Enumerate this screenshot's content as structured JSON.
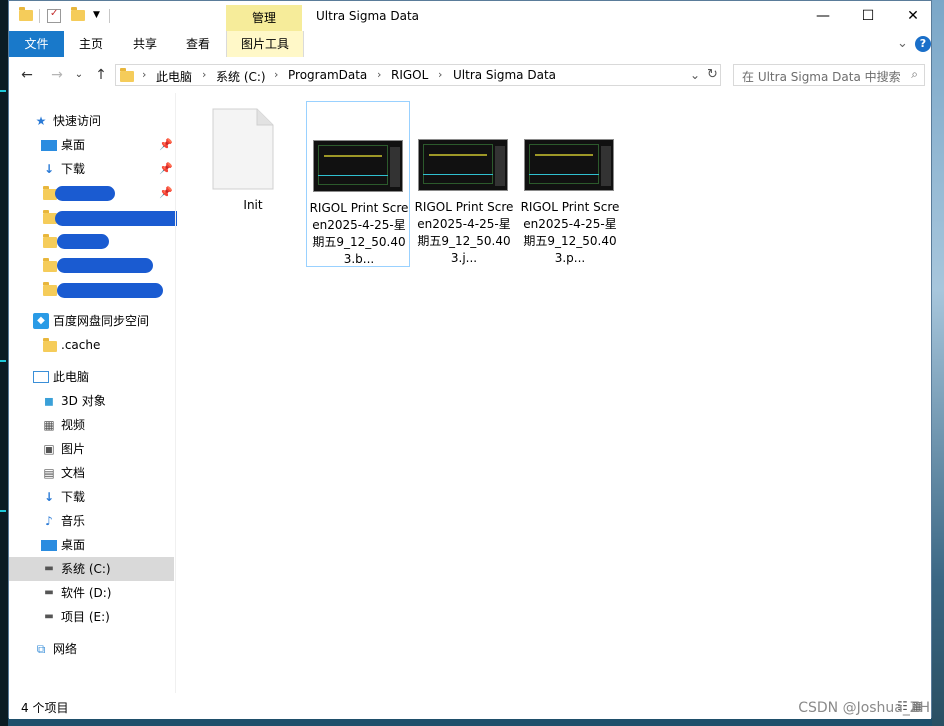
{
  "titlebar": {
    "manage_tab": "管理",
    "title": "Ultra Sigma Data",
    "minimize": "—",
    "maximize": "☐",
    "close": "✕"
  },
  "ribbon": {
    "tabs": [
      "文件",
      "主页",
      "共享",
      "查看",
      "图片工具"
    ],
    "expand": "⌄",
    "help": "?"
  },
  "address": {
    "segments": [
      "此电脑",
      "系统 (C:)",
      "ProgramData",
      "RIGOL",
      "Ultra Sigma Data"
    ],
    "search_placeholder": "在 Ultra Sigma Data 中搜索"
  },
  "sidebar": {
    "quick_access": "快速访问",
    "quick_items": [
      "桌面",
      "下载"
    ],
    "baidu": "百度网盘同步空间",
    "cache": ".cache",
    "this_pc": "此电脑",
    "pc_items": [
      "3D 对象",
      "视频",
      "图片",
      "文档",
      "下载",
      "音乐",
      "桌面",
      "系统 (C:)",
      "软件 (D:)",
      "项目 (E:)"
    ],
    "network": "网络"
  },
  "files": [
    {
      "name": "Init"
    },
    {
      "name": "RIGOL Print Screen2025-4-25-星期五9_12_50.403.b..."
    },
    {
      "name": "RIGOL Print Screen2025-4-25-星期五9_12_50.403.j..."
    },
    {
      "name": "RIGOL Print Screen2025-4-25-星期五9_12_50.403.p..."
    }
  ],
  "status": {
    "count": "4 个项目"
  },
  "watermark": "CSDN @Joshua_ZH",
  "colors": {
    "file_tab": "#1979ca",
    "manage_tab": "#f6ec9a",
    "selection": "#99d1ff"
  }
}
